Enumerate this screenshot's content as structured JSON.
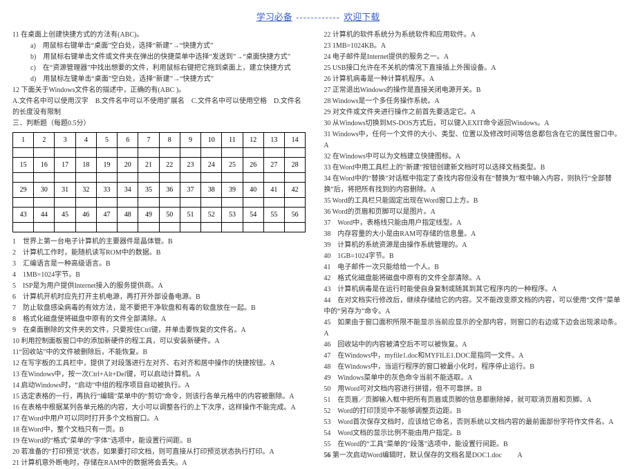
{
  "header": {
    "left": "学习必备",
    "divider": "------------",
    "right": "欢迎下载"
  },
  "left": {
    "q11": "11 在桌面上创建快捷方式的方法有(ABC)。",
    "q11a": "a)　用鼠标右键单击“桌面”空白处，选择“新建”→“快捷方式”",
    "q11b": "b)　用鼠标右键单击文件或文件夹在弹出的快捷菜单中选择“发送到”→“桌面快捷方式”",
    "q11c": "c)　在“资源管理器”中找出想要的文件，利用鼠标右键把它拖到桌面上，建立快捷方式",
    "q11d": "d)　用鼠标左键单击“桌面”空白处，选择“新建”→“快捷方式”",
    "q12": "12 下面关于Windows文件名的描述中，正确的有(ABC )。",
    "q12opts": "A.文件名中可以使用汉字　B.文件名中可以不使用扩展名　C.文件名中可以使用空格　D.文件名的长度没有限制",
    "section3": "三．判断题（每题0.5分）",
    "row1": [
      "1",
      "2",
      "3",
      "4",
      "5",
      "6",
      "7",
      "8",
      "9",
      "10",
      "11",
      "12",
      "13",
      "14"
    ],
    "row2": [
      "15",
      "16",
      "17",
      "18",
      "19",
      "20",
      "21",
      "22",
      "23",
      "24",
      "25",
      "26",
      "27",
      "28"
    ],
    "row3": [
      "29",
      "30",
      "31",
      "32",
      "33",
      "34",
      "35",
      "36",
      "37",
      "38",
      "39",
      "40",
      "41",
      "42"
    ],
    "row4": [
      "43",
      "44",
      "45",
      "46",
      "47",
      "48",
      "49",
      "50",
      "51",
      "52",
      "53",
      "54",
      "55",
      "56"
    ],
    "j1": "1　世界上第一台电子计算机的主要器件是晶体管。B",
    "j2": "2　计算机工作时，能随机读写ROM中的数据。B",
    "j3": "3　汇编语言是一种高级语言。B",
    "j4": "4　1MB=1024字节。B",
    "j5": "5　ISP是为用户提供Internet接入的服务提供商。A",
    "j6": "6　计算机开机时应先打开主机电源，再打开外部设备电源。B",
    "j7": "7　防止软盘感染病毒的有效方法，是不要把干净软盘和有毒的软盘放在一起。B",
    "j8": "8　格式化磁盘使将磁盘中原有的文件全部清除。A",
    "j9": "9　在桌面删除的文件夹的文件，只要按住Ctrl键，并单击要恢复的文件名。A",
    "j10": "10 利用控制面板窗口中的添加新硬件的程工具，可以安装新硬件。A",
    "j11": "11“回收站”中的文件被删除后，不能恢复。B",
    "j12": "12 在写字板的工具栏中，提供了对段落进行左对齐、右对齐和居中操作的快捷按钮。A",
    "j13": "13 在Windows中，按一次Ctrl+Alt+Del键，可以启动计算机。A",
    "j14": "14 启动Windows时，“启动”中组的程序项目自动被执行。A",
    "j15": "15 选定表格的一行，再执行“编辑”菜单中的“剪切”命令，则该行各单元格中的内容被删除。A",
    "j16": "16 在表格中根据某列各单元格的内容，大小可以调整各行的上下次序，这样操作不能完成。A",
    "j17": "17 在Word中用户可以同时打开多个文档窗口。A",
    "j18": "18 在Word中，整个文档只有一页。B",
    "j19": "19 在Word的“格式”菜单的“字体”选项中，能设置行间距。B",
    "j20": "20 若准备的“打印预览”状态，如果要打印文档，则可直接从打印预览状态执行打印。A",
    "j21": "21 计算机意外断电时，存储在RAM中的数据将会丢失。A"
  },
  "right": {
    "r22": "22 计算机的软件系统分为系统软件和应用软件。A",
    "r23": "23 1MB=1024KB。A",
    "r24": "24 电子邮件是Internet提供的服务之一。A",
    "r25": "25 USB接口允许在不关机的情况下直接插上外围设备。A",
    "r26": "26 计算机病毒是一种计算机程序。A",
    "r27": "27 正常退出Windows的操作是直接关闭电源开关。B",
    "r28": "28 Windows是一个多任务操作系统。A",
    "r29": "29 对文件或文件夹进行操作之前首先要选定它。A",
    "r30": "30 从Windows切换到MS-DOS方式后，可以键入EXIT命令返回Windows。A",
    "r31": "31 Windows中，任何一个文件的大小、类型、位置以及修改时间等信息都包含在它的属性窗口中。A",
    "r32": "32 在Windows中可以为文档建立快捷图标。A",
    "r33": "33 在Word中用工具栏上的“新建”按钮创建新文档时可以选择文档类型。B",
    "r34": "34 在Word中的“替换”对话框中指定了查找内容但没有在“替换为”框中输入内容，则执行“全部替换”后，将把所有找到的内容删除。A",
    "r35": "35 Word的工具栏只能固定出现在Word窗口上方。B",
    "r36": "36 Word的页眉和页脚可以是图片。A",
    "r37": "37　Word中，表格线只能由用户指定线型。A",
    "r38": "38　内存容量的大小是由RAM可存储的信息量。A",
    "r39": "39　计算机的系统资源是由操作系统管理的。A",
    "r40": "40　1GB=1024字节。B",
    "r41": "41　电子邮件一次只能给给一个人。B",
    "r42": "42　格式化磁盘能将磁盘中原有的文件全部清除。A",
    "r43": "43　计算机病毒是在运行时能使自身复制或随其到其它程序内的一种程序。A",
    "r44": "44　在对文档实行修改后，继续存储给它的内容。又不能改变原文档的内容，可以使用“文件”菜单中的“另存为”命令。A",
    "r45": "45　如果由于窗口面积所限不能显示当前应显示的全部内容，则窗口的右边或下边会出现滚动条。A",
    "r46": "46　回收站中的内容被清空后不可以被恢复。A",
    "r47": "47　在Windows中，myfile1.doc和MYFILE1.DOC是指同一文件。A",
    "r48": "48　在Windows中，当运行程序的窗口被最小化时，程序停止运行。B",
    "r49": "49　Windows菜单中的灰色命令当前不能选取。A",
    "r50": "50　用Word可对文档内容进行拼错，但不可靠拼。B",
    "r51": "51　在页眉／页脚输入框中把所有页眉或页脚的信息都删除掉，就可取消页眉和页脚。A",
    "r52": "52　Word的打印顶览中不能够调整页边距。B",
    "r53": "53　Word首次保存文档时，应该给它命名，否则系统以文档内容的最前面部份字符作文件名。A",
    "r54": "54　Word文档的显示比例不能由用户指定。B",
    "r55": "55　在Word的“工具”菜单的“段落”选项中，能设置行间距。B",
    "r56num": "56",
    "r56": " 第一次启动Word编辑时，默认保存的文档名是DOC1.doc 　　A"
  }
}
